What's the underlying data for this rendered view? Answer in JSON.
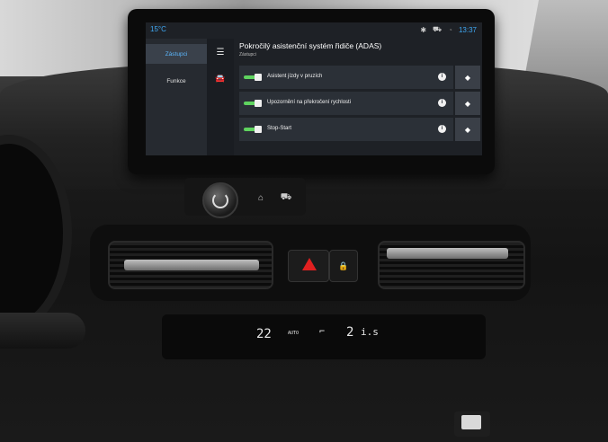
{
  "status": {
    "temperature": "15°C",
    "time": "13:37"
  },
  "nav": {
    "items": [
      {
        "label": "Zástupci",
        "active": true
      },
      {
        "label": "Funkce",
        "active": false
      }
    ]
  },
  "page": {
    "title": "Pokročilý asistenční systém řidiče (ADAS)",
    "subtitle": "Zástupci"
  },
  "features": [
    {
      "label": "Asistent jízdy v pruzích",
      "enabled": true
    },
    {
      "label": "Upozornění na překročení rychlosti",
      "enabled": true
    },
    {
      "label": "Stop-Start",
      "enabled": true
    }
  ],
  "climate": {
    "temp_left": "22",
    "mode": "AUTO",
    "fan": "2",
    "unit": "i.s"
  },
  "colors": {
    "accent": "#3fa9f5",
    "toggle_on": "#5fd35f",
    "hazard": "#e02020"
  }
}
